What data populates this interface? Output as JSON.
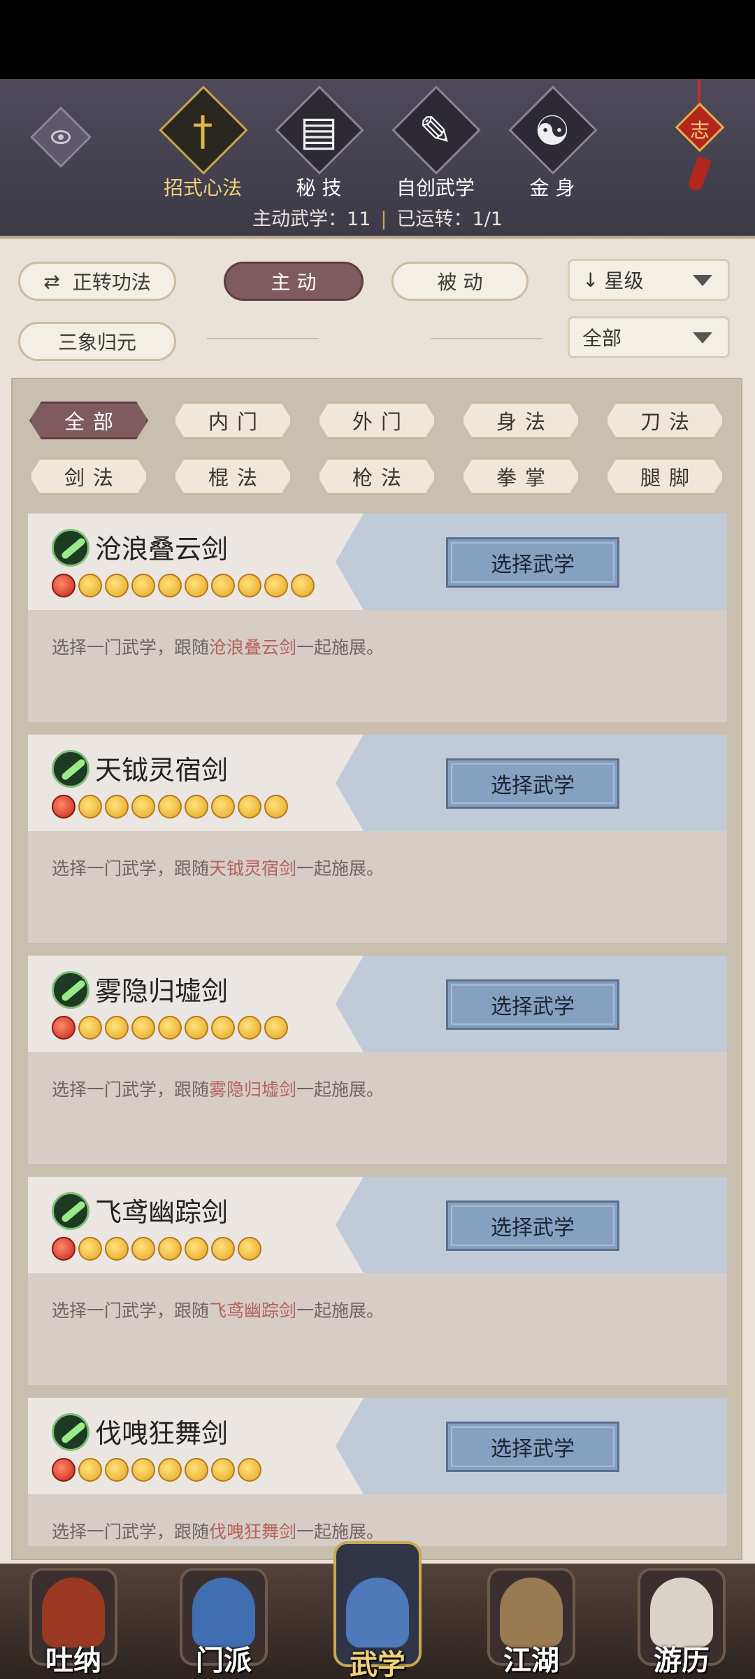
{
  "header": {
    "tabs": [
      {
        "label": "招式心法",
        "icon": "sword-icon",
        "glyph": "†"
      },
      {
        "label": "秘  技",
        "icon": "book-icon",
        "glyph": "▤"
      },
      {
        "label": "自创武学",
        "icon": "scroll-icon",
        "glyph": "✎"
      },
      {
        "label": "金  身",
        "icon": "meditation-icon",
        "glyph": "☯"
      }
    ],
    "knot_glyph": "志",
    "stats": {
      "active_label": "主动武学：11",
      "running_label": "已运转：1/1"
    }
  },
  "filters": {
    "forward_btn": "正转功法",
    "active_btn": "主  动",
    "passive_btn": "被  动",
    "sanxiang_btn": "三象归元",
    "sort_select": "星级",
    "range_select": "全部"
  },
  "categories": [
    "全部",
    "内门",
    "外门",
    "身法",
    "刀法",
    "剑法",
    "棍法",
    "枪法",
    "拳掌",
    "腿脚"
  ],
  "skills": [
    {
      "name": "沧浪叠云剑",
      "stars": 10,
      "button": "选择武学",
      "desc_pre": "选择一门武学，跟随",
      "desc_name": "沧浪叠云剑",
      "desc_post": "一起施展。"
    },
    {
      "name": "天钺灵宿剑",
      "stars": 9,
      "button": "选择武学",
      "desc_pre": "选择一门武学，跟随",
      "desc_name": "天钺灵宿剑",
      "desc_post": "一起施展。"
    },
    {
      "name": "雾隐归墟剑",
      "stars": 9,
      "button": "选择武学",
      "desc_pre": "选择一门武学，跟随",
      "desc_name": "雾隐归墟剑",
      "desc_post": "一起施展。"
    },
    {
      "name": "飞鸢幽踪剑",
      "stars": 8,
      "button": "选择武学",
      "desc_pre": "选择一门武学，跟随",
      "desc_name": "飞鸢幽踪剑",
      "desc_post": "一起施展。"
    },
    {
      "name": "伐㖂狂舞剑",
      "stars": 8,
      "button": "选择武学",
      "desc_pre": "选择一门武学，跟随",
      "desc_name": "伐㖂狂舞剑",
      "desc_post": "一起施展。"
    }
  ],
  "nav": [
    {
      "label": "吐纳",
      "icon": "monk-icon",
      "color": "#9a3a22"
    },
    {
      "label": "门派",
      "icon": "banner-icon",
      "color": "#3f6fb0"
    },
    {
      "label": "武学",
      "icon": "manual-icon",
      "color": "#4f79b8"
    },
    {
      "label": "江湖",
      "icon": "straw-hat-icon",
      "color": "#9a7a52"
    },
    {
      "label": "游历",
      "icon": "horse-icon",
      "color": "#d9d2c8"
    }
  ],
  "colors": {
    "accent": "#7f5a5f",
    "gold": "#c9a84f",
    "highlight": "#b7615a"
  }
}
